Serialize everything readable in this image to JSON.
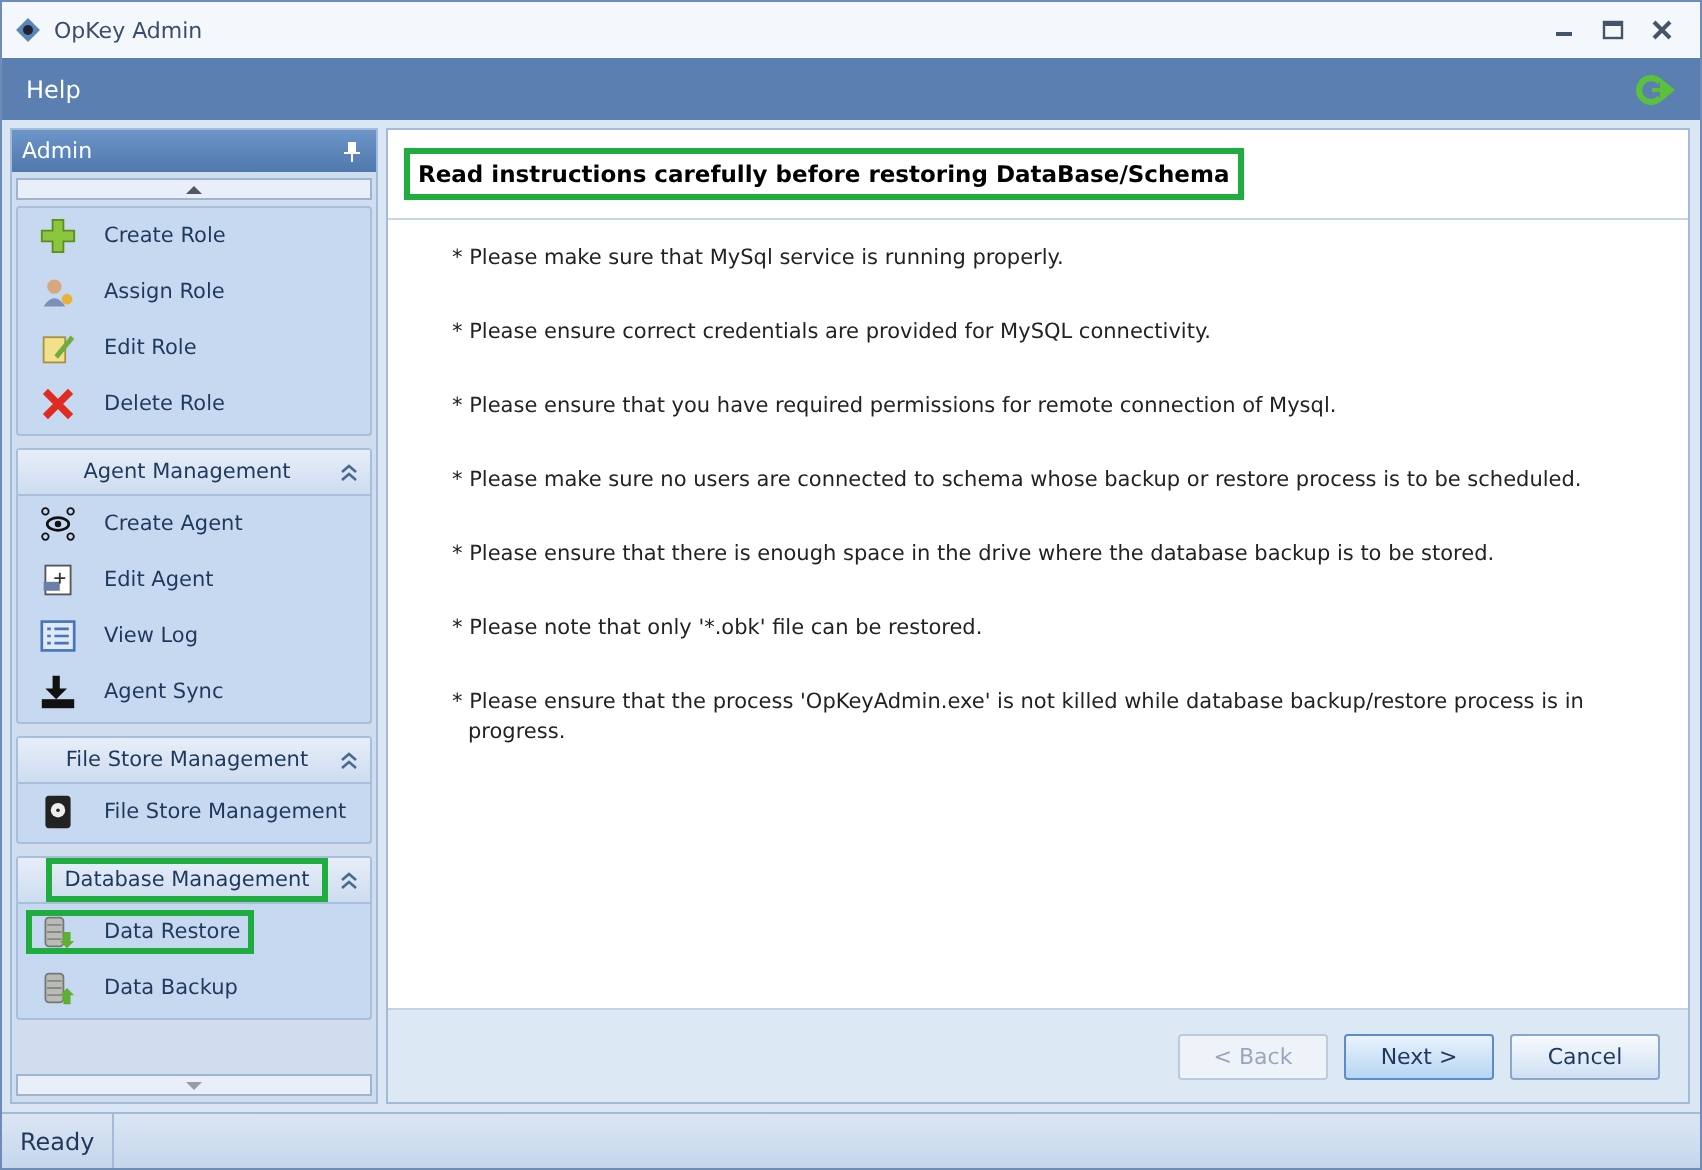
{
  "window": {
    "title": "OpKey Admin"
  },
  "menu": [
    "Help"
  ],
  "sidebar": {
    "title": "Admin",
    "groups": [
      {
        "items": [
          {
            "label": "Create Role",
            "highlighted": false
          },
          {
            "label": "Assign Role",
            "highlighted": false
          },
          {
            "label": "Edit Role",
            "highlighted": false
          },
          {
            "label": "Delete Role",
            "highlighted": false
          }
        ]
      },
      {
        "title": "Agent Management",
        "highlighted": false,
        "items": [
          {
            "label": "Create Agent",
            "highlighted": false
          },
          {
            "label": "Edit Agent",
            "highlighted": false
          },
          {
            "label": "View Log",
            "highlighted": false
          },
          {
            "label": "Agent Sync",
            "highlighted": false
          }
        ]
      },
      {
        "title": "File Store Management",
        "highlighted": false,
        "items": [
          {
            "label": "File Store Management",
            "highlighted": false
          }
        ]
      },
      {
        "title": "Database Management",
        "highlighted": true,
        "items": [
          {
            "label": "Data Restore",
            "highlighted": true
          },
          {
            "label": "Data Backup",
            "highlighted": false
          }
        ]
      }
    ]
  },
  "panel": {
    "heading": "Read instructions carefully before restoring DataBase/Schema",
    "heading_highlighted": true,
    "instructions": [
      "* Please make sure that MySql service is running properly.",
      "* Please ensure correct credentials are provided for MySQL connectivity.",
      "* Please ensure that you have required permissions for remote connection of Mysql.",
      "* Please make sure no users are connected to schema whose backup or restore process is to be scheduled.",
      "* Please ensure that there is enough space in the drive where the database backup is to be stored.",
      "* Please note that only '*.obk' file can be restored.",
      "* Please ensure that the process 'OpKeyAdmin.exe' is not killed while database backup/restore process is in progress."
    ],
    "buttons": [
      {
        "label": "< Back",
        "disabled": true,
        "default": false
      },
      {
        "label": "Next >",
        "disabled": false,
        "default": true
      },
      {
        "label": "Cancel",
        "disabled": false,
        "default": false
      }
    ]
  },
  "status_bar": "Ready"
}
